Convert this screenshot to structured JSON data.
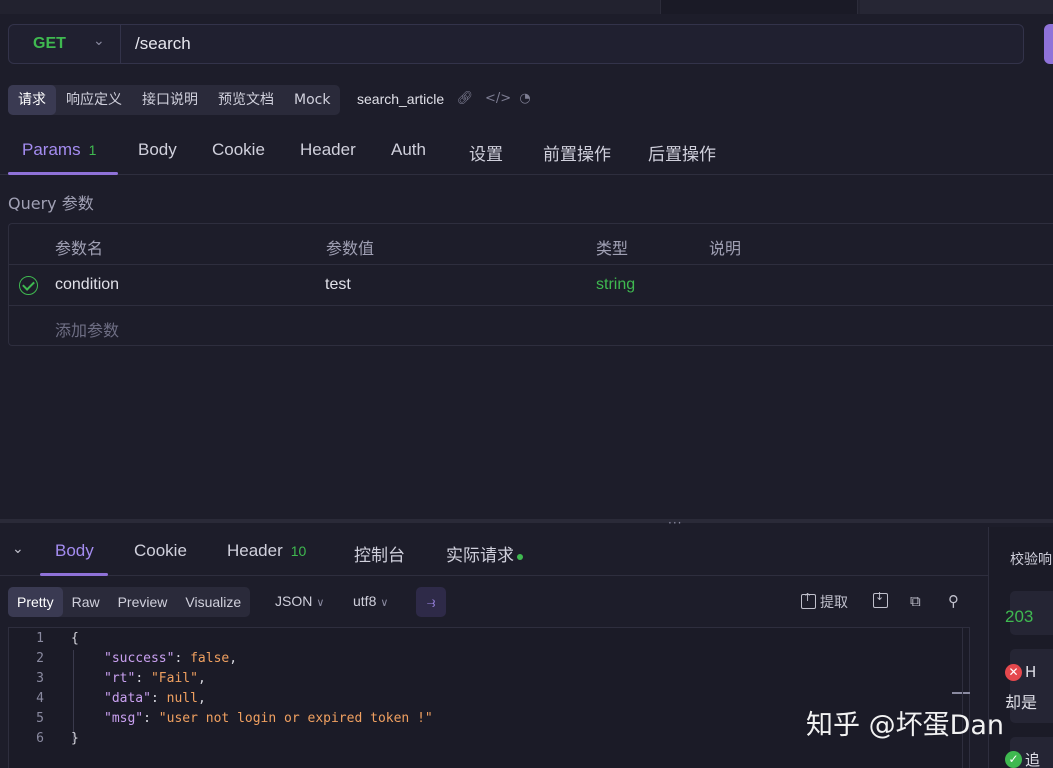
{
  "request": {
    "method": "GET",
    "url": "/search",
    "sub_tabs": [
      "请求",
      "响应定义",
      "接口说明",
      "预览文档",
      "Mock"
    ],
    "api_name": "search_article",
    "tabs": [
      {
        "label": "Params",
        "badge": "1"
      },
      {
        "label": "Body"
      },
      {
        "label": "Cookie"
      },
      {
        "label": "Header"
      },
      {
        "label": "Auth"
      },
      {
        "label": "设置"
      },
      {
        "label": "前置操作"
      },
      {
        "label": "后置操作"
      }
    ]
  },
  "query": {
    "label": "Query 参数",
    "columns": [
      "参数名",
      "参数值",
      "类型",
      "说明"
    ],
    "rows": [
      {
        "name": "condition",
        "value": "test",
        "type": "string",
        "description": "",
        "enabled": true
      }
    ],
    "add_placeholder": "添加参数"
  },
  "response": {
    "tabs": [
      {
        "label": "Body"
      },
      {
        "label": "Cookie"
      },
      {
        "label": "Header",
        "badge": "10"
      },
      {
        "label": "控制台"
      },
      {
        "label": "实际请求"
      }
    ],
    "formats": [
      "Pretty",
      "Raw",
      "Preview",
      "Visualize"
    ],
    "type_select": "JSON",
    "encoding_select": "utf8",
    "extract_label": "提取",
    "code_lines": [
      {
        "num": "1",
        "text": "{"
      },
      {
        "num": "2",
        "key": "\"success\"",
        "val": "false",
        "sep": ","
      },
      {
        "num": "3",
        "key": "\"rt\"",
        "val": "\"Fail\"",
        "sep": ","
      },
      {
        "num": "4",
        "key": "\"data\"",
        "val": "null",
        "sep": ","
      },
      {
        "num": "5",
        "key": "\"msg\"",
        "val": "\"user not login or expired token !\"",
        "sep": ""
      },
      {
        "num": "6",
        "text": "}"
      }
    ]
  },
  "side_panel": {
    "title": "校验响",
    "status_code": "203",
    "error_title": "H",
    "error_text": "却是",
    "ok_title": "追"
  },
  "watermark": "知乎 @坏蛋Dan",
  "colors": {
    "accent": "#8f72d9",
    "success": "#3fb950",
    "error": "#e5484d",
    "background": "#1d1d2a"
  }
}
